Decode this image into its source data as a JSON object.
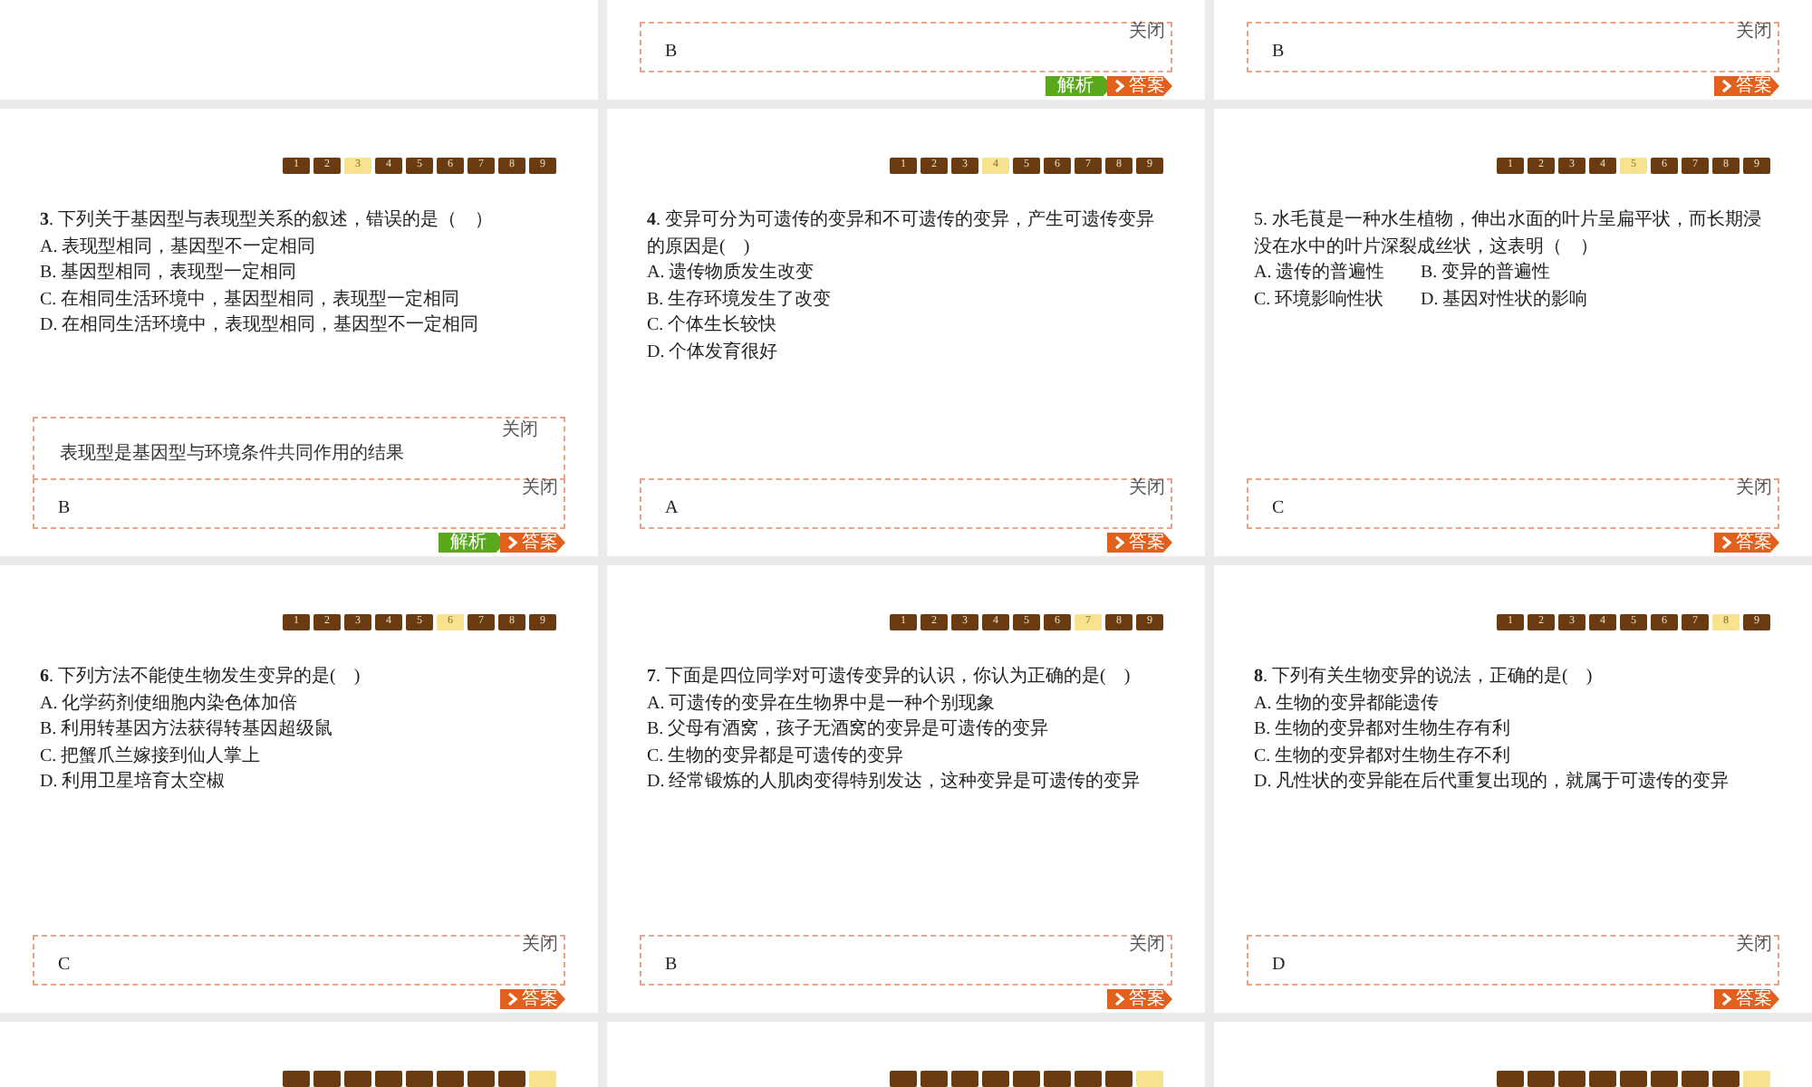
{
  "slides": [
    {
      "kind": "blank"
    },
    {
      "kind": "question",
      "answer_box": {
        "close_label": "关闭",
        "answer": "B"
      },
      "buttons": [
        {
          "kind": "analysis",
          "label": "解析"
        },
        {
          "kind": "answer",
          "label": "答案"
        }
      ]
    },
    {
      "kind": "question",
      "answer_box": {
        "close_label": "关闭",
        "answer": "B"
      },
      "buttons": [
        {
          "kind": "answer",
          "label": "答案"
        }
      ]
    },
    {
      "kind": "question",
      "nav": [
        {
          "label": "1",
          "selected": false
        },
        {
          "label": "2",
          "selected": false
        },
        {
          "label": "3",
          "selected": true
        },
        {
          "label": "4",
          "selected": false
        },
        {
          "label": "5",
          "selected": false
        },
        {
          "label": "6",
          "selected": false
        },
        {
          "label": "7",
          "selected": false
        },
        {
          "label": "8",
          "selected": false
        },
        {
          "label": "9",
          "selected": false
        }
      ],
      "question": "**3**. 下列关于基因型与表现型关系的叙述，错误的是（　）",
      "option_rows": [
        [
          "A. 表现型相同，基因型不一定相同"
        ],
        [
          "B. 基因型相同，表现型一定相同"
        ],
        [
          "C. 在相同生活环境中，基因型相同，表现型一定相同"
        ],
        [
          "D. 在相同生活环境中，表现型相同，基因型不一定相同"
        ]
      ],
      "explanation_box": {
        "close_label": "关闭",
        "text": "表现型是基因型与环境条件共同作用的结果"
      },
      "answer_box": {
        "close_label": "关闭",
        "answer": "B"
      },
      "buttons": [
        {
          "kind": "analysis",
          "label": "解析"
        },
        {
          "kind": "answer",
          "label": "答案"
        }
      ]
    },
    {
      "kind": "question",
      "nav": [
        {
          "label": "1",
          "selected": false
        },
        {
          "label": "2",
          "selected": false
        },
        {
          "label": "3",
          "selected": false
        },
        {
          "label": "4",
          "selected": true
        },
        {
          "label": "5",
          "selected": false
        },
        {
          "label": "6",
          "selected": false
        },
        {
          "label": "7",
          "selected": false
        },
        {
          "label": "8",
          "selected": false
        },
        {
          "label": "9",
          "selected": false
        }
      ],
      "question": "**4**. 变异可分为可遗传的变异和不可遗传的变异，产生可遗传变异的原因是(　)",
      "option_rows": [
        [
          "A. 遗传物质发生改变"
        ],
        [
          "B. 生存环境发生了改变"
        ],
        [
          "C. 个体生长较快"
        ],
        [
          "D. 个体发育很好"
        ]
      ],
      "answer_box": {
        "close_label": "关闭",
        "answer": "A"
      },
      "buttons": [
        {
          "kind": "answer",
          "label": "答案"
        }
      ]
    },
    {
      "kind": "question",
      "nav": [
        {
          "label": "1",
          "selected": false
        },
        {
          "label": "2",
          "selected": false
        },
        {
          "label": "3",
          "selected": false
        },
        {
          "label": "4",
          "selected": false
        },
        {
          "label": "5",
          "selected": true
        },
        {
          "label": "6",
          "selected": false
        },
        {
          "label": "7",
          "selected": false
        },
        {
          "label": "8",
          "selected": false
        },
        {
          "label": "9",
          "selected": false
        }
      ],
      "question": "5. 水毛茛是一种水生植物，伸出水面的叶片呈扁平状，而长期浸没在水中的叶片深裂成丝状，这表明（　）",
      "option_rows": [
        [
          "A. 遗传的普遍性",
          "B. 变异的普遍性"
        ],
        [
          "C. 环境影响性状",
          "D. 基因对性状的影响"
        ]
      ],
      "answer_box": {
        "close_label": "关闭",
        "answer": "C"
      },
      "buttons": [
        {
          "kind": "answer",
          "label": "答案"
        }
      ]
    },
    {
      "kind": "question",
      "nav": [
        {
          "label": "1",
          "selected": false
        },
        {
          "label": "2",
          "selected": false
        },
        {
          "label": "3",
          "selected": false
        },
        {
          "label": "4",
          "selected": false
        },
        {
          "label": "5",
          "selected": false
        },
        {
          "label": "6",
          "selected": true
        },
        {
          "label": "7",
          "selected": false
        },
        {
          "label": "8",
          "selected": false
        },
        {
          "label": "9",
          "selected": false
        }
      ],
      "question": "**6**. 下列方法不能使生物发生变异的是(　)",
      "option_rows": [
        [
          "A. 化学药剂使细胞内染色体加倍"
        ],
        [
          "B. 利用转基因方法获得转基因超级鼠"
        ],
        [
          "C. 把蟹爪兰嫁接到仙人掌上"
        ],
        [
          "D. 利用卫星培育太空椒"
        ]
      ],
      "answer_box": {
        "close_label": "关闭",
        "answer": "C"
      },
      "buttons": [
        {
          "kind": "answer",
          "label": "答案"
        }
      ]
    },
    {
      "kind": "question",
      "nav": [
        {
          "label": "1",
          "selected": false
        },
        {
          "label": "2",
          "selected": false
        },
        {
          "label": "3",
          "selected": false
        },
        {
          "label": "4",
          "selected": false
        },
        {
          "label": "5",
          "selected": false
        },
        {
          "label": "6",
          "selected": false
        },
        {
          "label": "7",
          "selected": true
        },
        {
          "label": "8",
          "selected": false
        },
        {
          "label": "9",
          "selected": false
        }
      ],
      "question": "**7**. 下面是四位同学对可遗传变异的认识，你认为正确的是(　)",
      "option_rows": [
        [
          "A. 可遗传的变异在生物界中是一种个别现象"
        ],
        [
          "B. 父母有酒窝，孩子无酒窝的变异是可遗传的变异"
        ],
        [
          "C. 生物的变异都是可遗传的变异"
        ],
        [
          "D. 经常锻炼的人肌肉变得特别发达，这种变异是可遗传的变异"
        ]
      ],
      "answer_box": {
        "close_label": "关闭",
        "answer": "B"
      },
      "buttons": [
        {
          "kind": "answer",
          "label": "答案"
        }
      ]
    },
    {
      "kind": "question",
      "nav": [
        {
          "label": "1",
          "selected": false
        },
        {
          "label": "2",
          "selected": false
        },
        {
          "label": "3",
          "selected": false
        },
        {
          "label": "4",
          "selected": false
        },
        {
          "label": "5",
          "selected": false
        },
        {
          "label": "6",
          "selected": false
        },
        {
          "label": "7",
          "selected": false
        },
        {
          "label": "8",
          "selected": true
        },
        {
          "label": "9",
          "selected": false
        }
      ],
      "question": "**8**. 下列有关生物变异的说法，正确的是(　)",
      "option_rows": [
        [
          "A. 生物的变异都能遗传"
        ],
        [
          "B. 生物的变异都对生物生存有利"
        ],
        [
          "C. 生物的变异都对生物生存不利"
        ],
        [
          "D. 凡性状的变异能在后代重复出现的，就属于可遗传的变异"
        ]
      ],
      "answer_box": {
        "close_label": "关闭",
        "answer": "D"
      },
      "buttons": [
        {
          "kind": "answer",
          "label": "答案"
        }
      ]
    },
    {
      "kind": "question",
      "nav": [
        {
          "selected": false
        },
        {
          "selected": false
        },
        {
          "selected": false
        },
        {
          "selected": false
        },
        {
          "selected": false
        },
        {
          "selected": false
        },
        {
          "selected": false
        },
        {
          "selected": false
        },
        {
          "selected": true
        }
      ]
    },
    {
      "kind": "question",
      "nav": [
        {
          "selected": false
        },
        {
          "selected": false
        },
        {
          "selected": false
        },
        {
          "selected": false
        },
        {
          "selected": false
        },
        {
          "selected": false
        },
        {
          "selected": false
        },
        {
          "selected": false
        },
        {
          "selected": true
        }
      ]
    },
    {
      "kind": "question",
      "nav": [
        {
          "selected": false
        },
        {
          "selected": false
        },
        {
          "selected": false
        },
        {
          "selected": false
        },
        {
          "selected": false
        },
        {
          "selected": false
        },
        {
          "selected": false
        },
        {
          "selected": false
        },
        {
          "selected": true
        }
      ]
    }
  ]
}
